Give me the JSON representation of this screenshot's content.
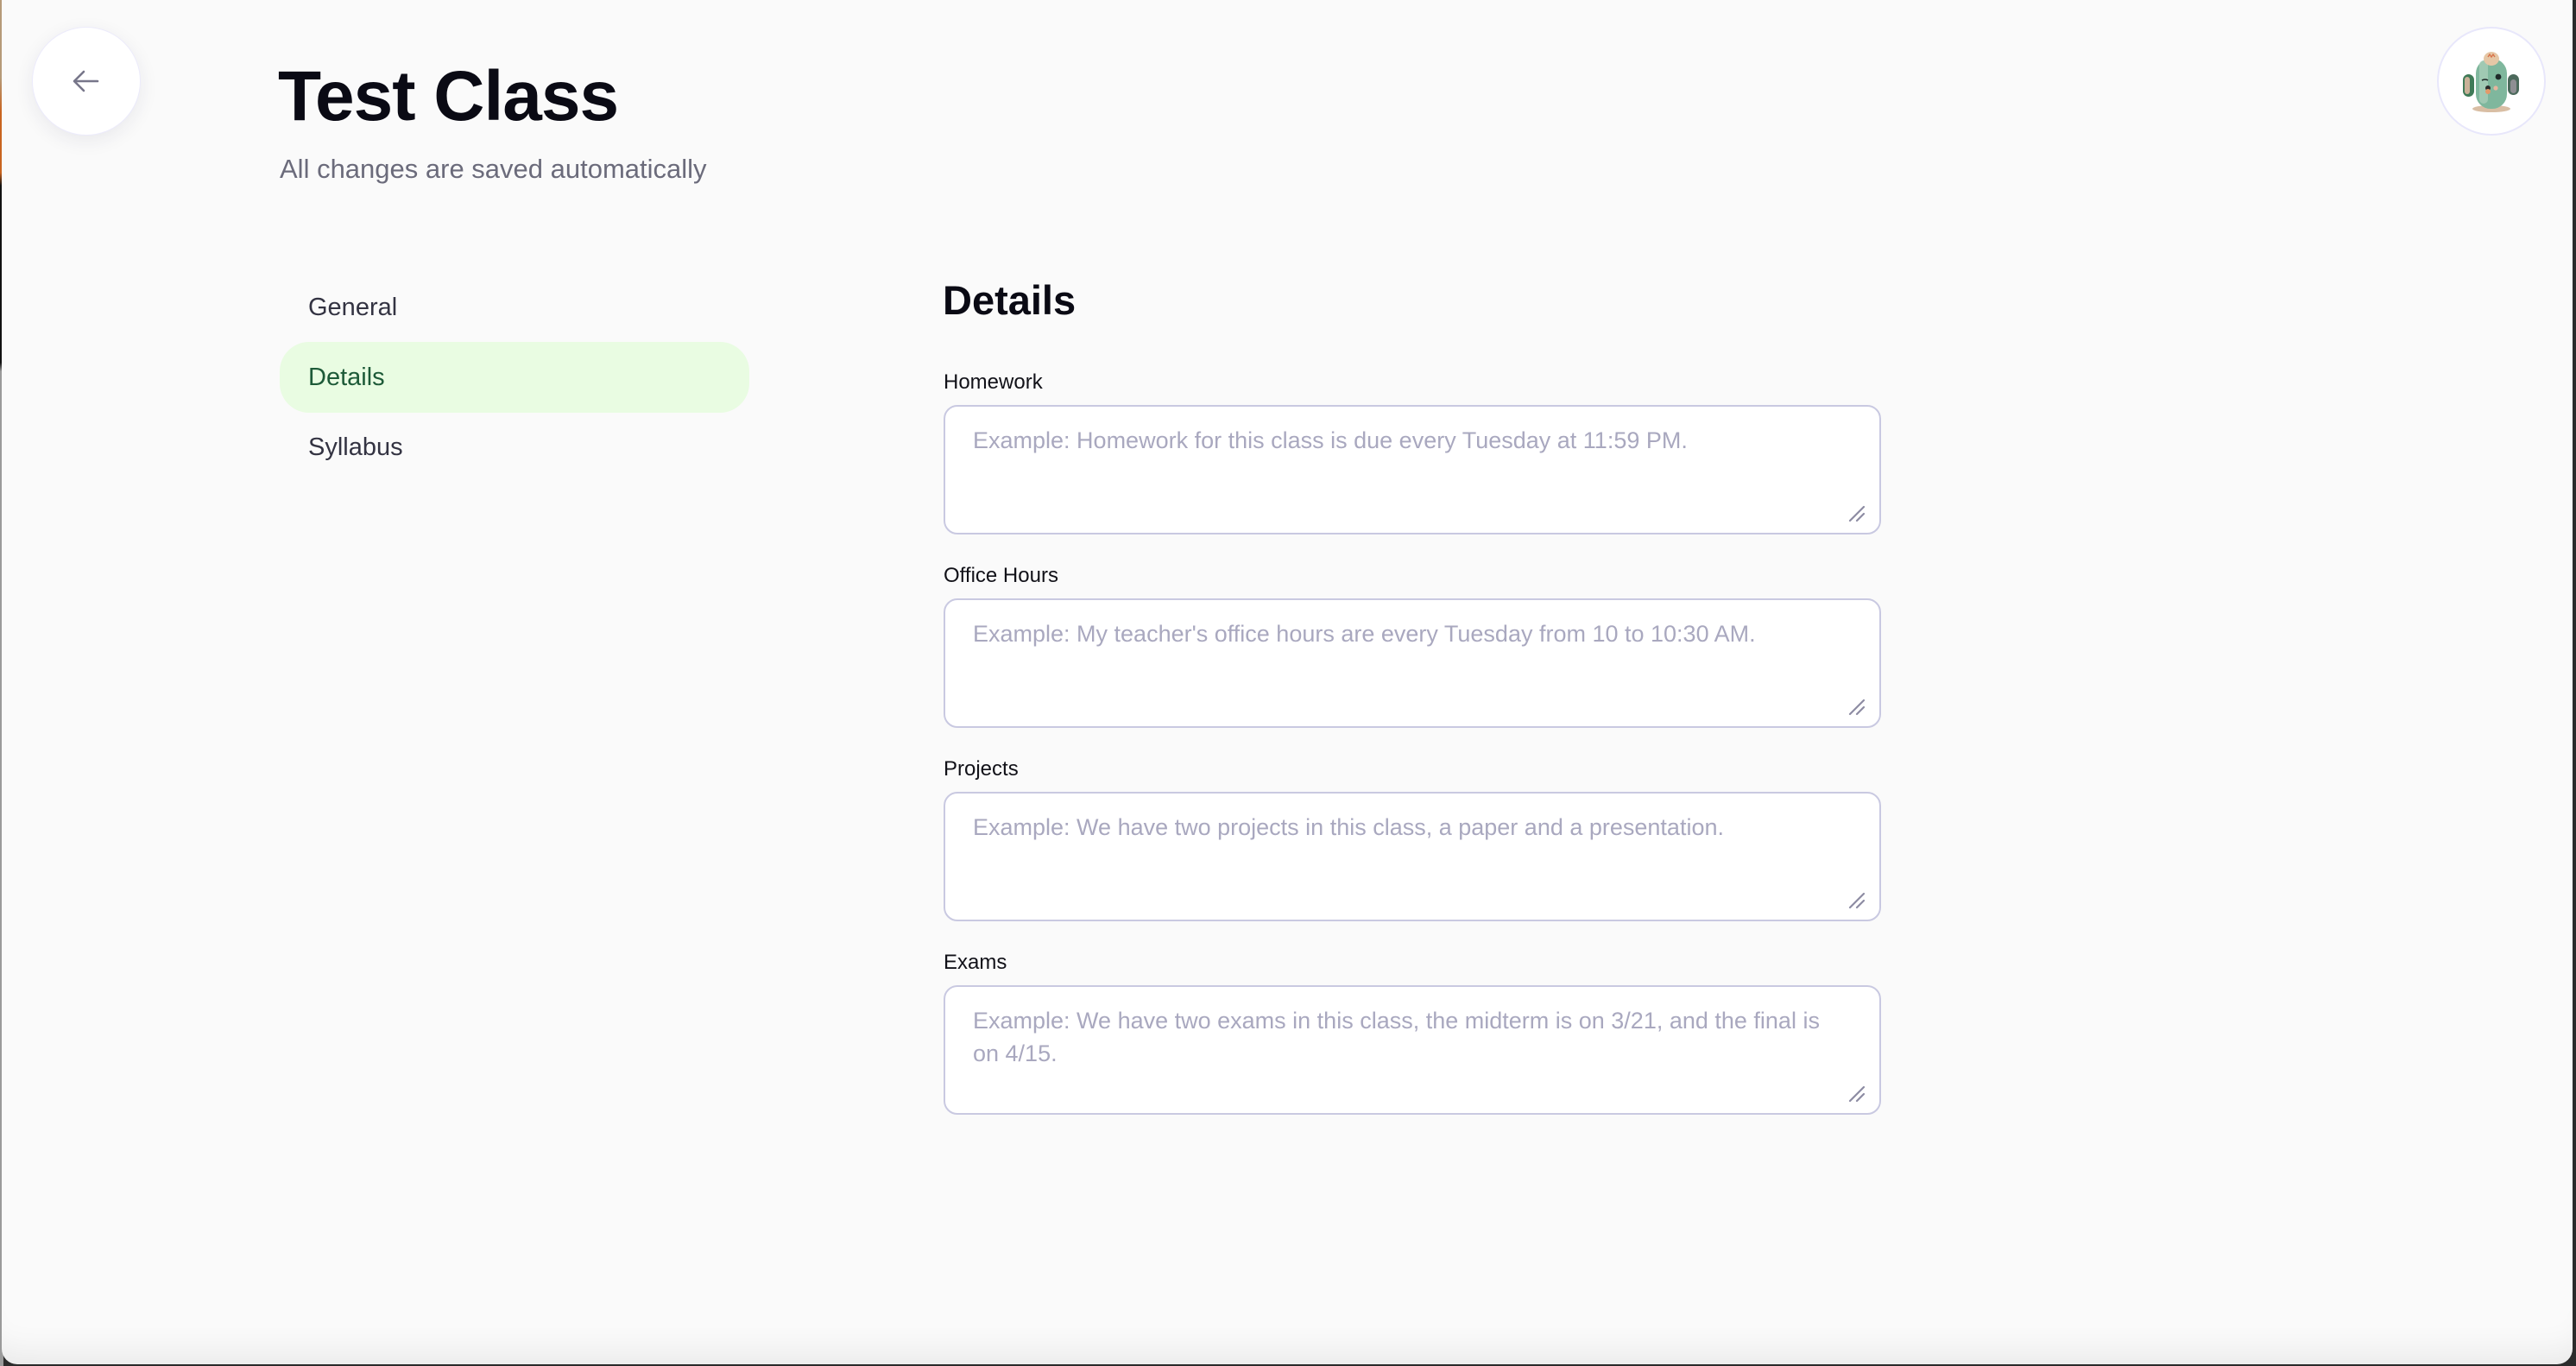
{
  "header": {
    "back_button_label": "Back",
    "title": "Test Class",
    "subtitle": "All changes are saved automatically",
    "avatar_alt": "Cactus avatar"
  },
  "sidebar": {
    "items": [
      {
        "label": "General",
        "active": false
      },
      {
        "label": "Details",
        "active": true
      },
      {
        "label": "Syllabus",
        "active": false
      }
    ]
  },
  "main": {
    "section_title": "Details",
    "fields": [
      {
        "label": "Homework",
        "value": "",
        "placeholder": "Example: Homework for this class is due every Tuesday at 11:59 PM."
      },
      {
        "label": "Office Hours",
        "value": "",
        "placeholder": "Example: My teacher's office hours are every Tuesday from 10 to 10:30 AM."
      },
      {
        "label": "Projects",
        "value": "",
        "placeholder": "Example: We have two projects in this class, a paper and a presentation."
      },
      {
        "label": "Exams",
        "value": "",
        "placeholder": "Example: We have two exams in this class, the midterm is on 3/21, and the final is on 4/15."
      }
    ]
  },
  "colors": {
    "active_nav_bg": "#e9fce2",
    "active_nav_text": "#1d5a38",
    "field_border": "#c9c9e1",
    "placeholder": "#a9a8bf"
  }
}
